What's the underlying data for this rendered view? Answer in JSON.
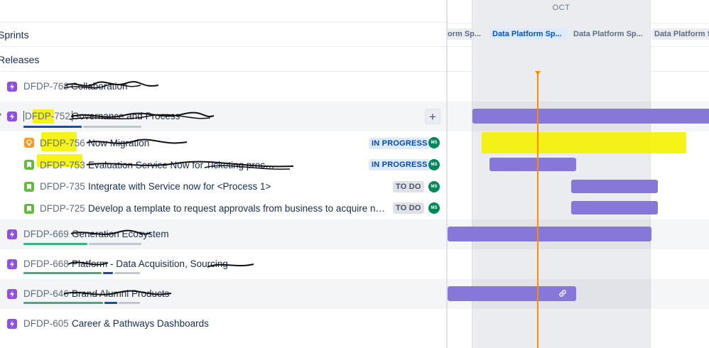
{
  "headers": {
    "sprints": "Sprints",
    "releases": "Releases"
  },
  "timeline": {
    "month": "OCT",
    "sprints": [
      {
        "label": "orm Sp...",
        "state": "past"
      },
      {
        "label": "Data Platform Sp...",
        "state": "active"
      },
      {
        "label": "Data Platform Sp...",
        "state": "future"
      },
      {
        "label": "Data Platform S",
        "state": "future"
      }
    ]
  },
  "issues": [
    {
      "key": "DFDP-768",
      "summary": "Collaboration",
      "type": "epic"
    },
    {
      "key": "DFDP-752",
      "summary": "Governance and Process",
      "type": "epic"
    },
    {
      "key": "DFDP-756",
      "summary": "Now Migration",
      "type": "bug",
      "status": "IN PROGRESS",
      "assignee": "MS"
    },
    {
      "key": "DFDP-753",
      "summary": "Evaluation Service Now for Ticketing process",
      "type": "story",
      "status": "IN PROGRESS",
      "assignee": "MS"
    },
    {
      "key": "DFDP-735",
      "summary": "Integrate with Service now for <Process 1>",
      "type": "story",
      "status": "TO DO",
      "assignee": "MS"
    },
    {
      "key": "DFDP-725",
      "summary": "Develop a template to request approvals from business to acquire ne...",
      "type": "story",
      "status": "TO DO",
      "assignee": "MS"
    },
    {
      "key": "DFDP-669",
      "summary": "Generation Ecosystem",
      "type": "epic"
    },
    {
      "key": "DFDP-668",
      "summary": "Platform - Data Acquisition, Sourcing",
      "type": "epic"
    },
    {
      "key": "DFDP-646",
      "summary": "Brand Alumni Products",
      "type": "epic"
    },
    {
      "key": "DFDP-605",
      "summary": "Career & Pathways Dashboards",
      "type": "epic"
    }
  ],
  "icons": {
    "epic": "lightning-icon",
    "story": "bookmark-icon",
    "bug": "lightbulb-icon",
    "add": "plus-icon",
    "link": "link-icon"
  },
  "colors": {
    "epic": "#904ee2",
    "story": "#63ba3c",
    "bug": "#ff991f",
    "bar": "#8777d9",
    "today": "#ff8b00",
    "highlight": "#f5f200",
    "done": "#36b37e",
    "inprogress": "#0052cc",
    "todo": "#c1c7d0"
  }
}
